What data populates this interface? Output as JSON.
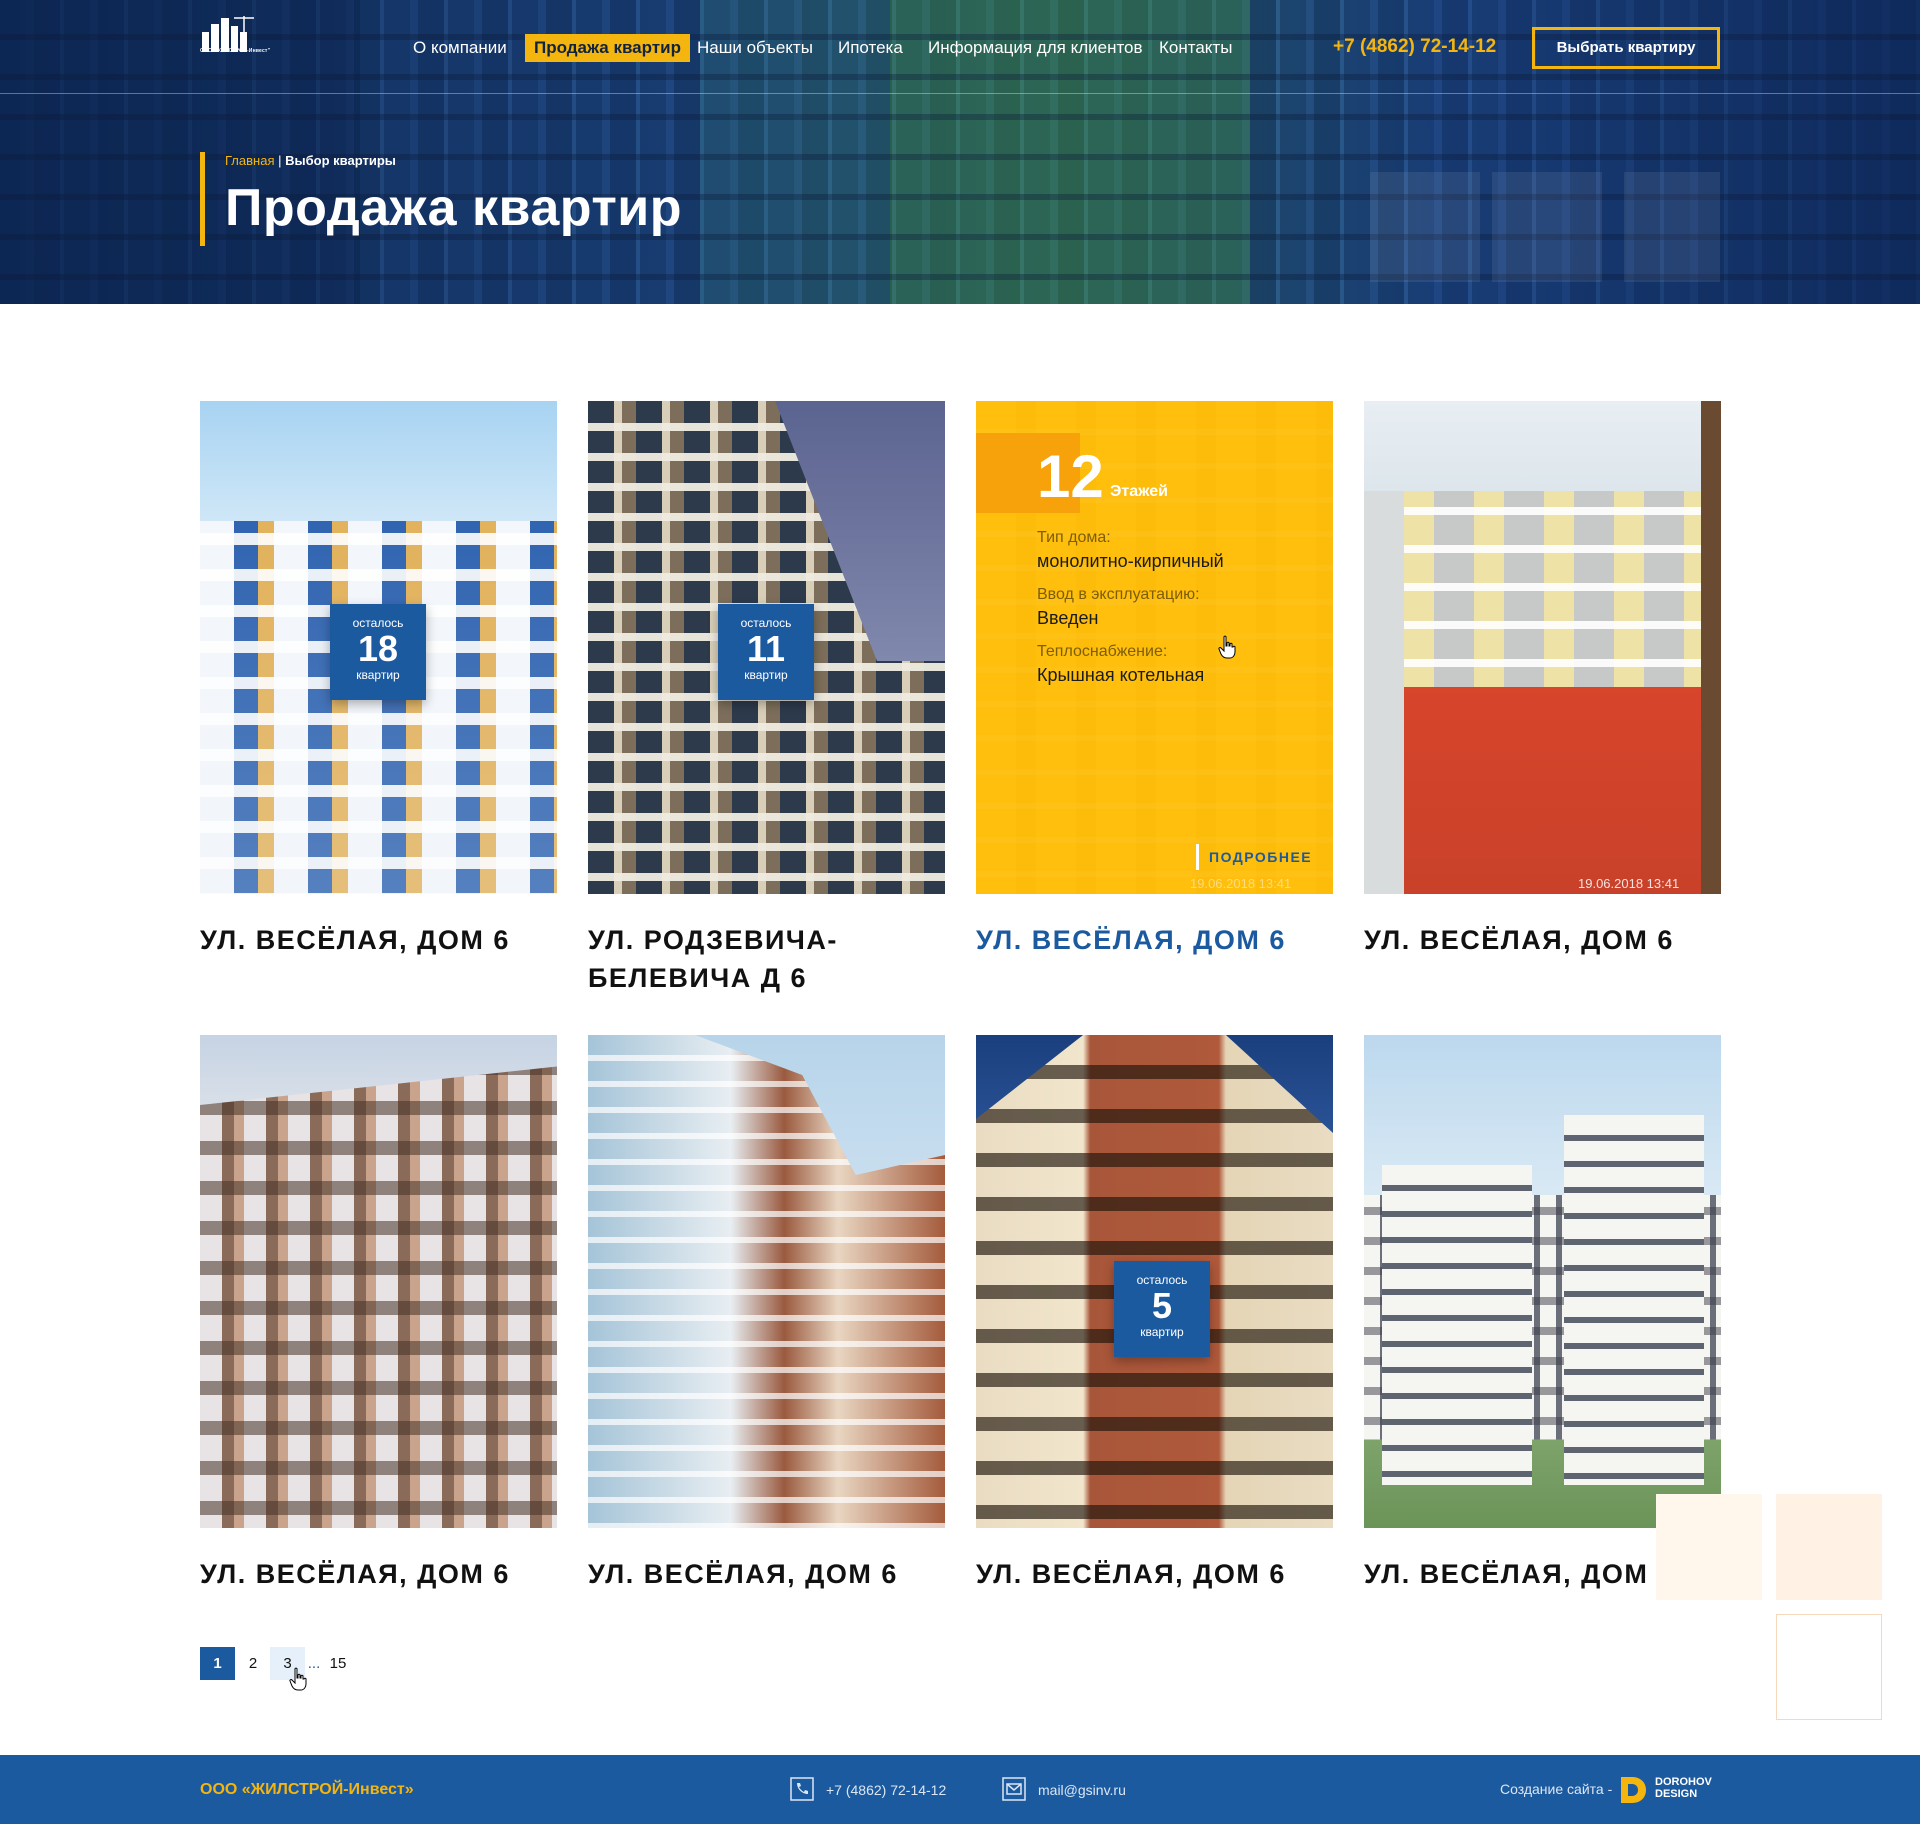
{
  "colors": {
    "accent": "#f5b50f",
    "primary": "#1c5aa0",
    "footer_bg": "#1c5aa0"
  },
  "header": {
    "logo_text": "ООО \"ЖИЛСТРОЙ-Инвест\"",
    "nav": [
      {
        "label": "О компании"
      },
      {
        "label": "Продажа квартир"
      },
      {
        "label": "Наши объекты"
      },
      {
        "label": "Ипотека"
      },
      {
        "label": "Информация для клиентов"
      },
      {
        "label": "Контакты"
      }
    ],
    "phone": "+7 (4862) 72-14-12",
    "cta_label": "Выбрать квартиру"
  },
  "breadcrumb": {
    "home": "Главная",
    "separator": "|",
    "current": "Выбор квартиры"
  },
  "page_title": "Продажа квартир",
  "cards": [
    {
      "title": "УЛ. ВЕСЁЛАЯ, ДОМ 6",
      "badge": {
        "top": "осталось",
        "count": "18",
        "bottom": "квартир"
      }
    },
    {
      "title": "УЛ. РОДЗЕВИЧА-БЕЛЕВИЧА Д 6",
      "badge": {
        "top": "осталось",
        "count": "11",
        "bottom": "квартир"
      }
    },
    {
      "title": "УЛ. ВЕСЁЛАЯ, ДОМ 6",
      "overlay": {
        "floors": "12",
        "floors_label": "Этажей",
        "house_type_label": "Тип дома:",
        "house_type_value": "монолитно-кирпичный",
        "commission_label": "Ввод в эксплуатацию:",
        "commission_value": "Введен",
        "heating_label": "Теплоснабжение:",
        "heating_value": "Крышная котельная",
        "more_label": "ПОДРОБНЕЕ",
        "photo_stamp": "19.06.2018 13:41"
      }
    },
    {
      "title": "УЛ. ВЕСЁЛАЯ, ДОМ 6",
      "photo_stamp": "19.06.2018  13:41"
    },
    {
      "title": "УЛ. ВЕСЁЛАЯ, ДОМ 6"
    },
    {
      "title": "УЛ. ВЕСЁЛАЯ, ДОМ 6"
    },
    {
      "title": "УЛ. ВЕСЁЛАЯ, ДОМ 6",
      "badge": {
        "top": "осталось",
        "count": "5",
        "bottom": "квартир"
      }
    },
    {
      "title": "УЛ. ВЕСЁЛАЯ, ДОМ 6"
    }
  ],
  "pagination": {
    "pages": [
      "1",
      "2",
      "3"
    ],
    "dots": "...",
    "last": "15",
    "current": "1"
  },
  "footer": {
    "company": "ООО «ЖИЛСТРОЙ-Инвест»",
    "phone": "+7 (4862) 72-14-12",
    "email": "mail@gsinv.ru",
    "credit": "Создание сайта -",
    "studio_line1": "DOROHOV",
    "studio_line2": "DESIGN"
  }
}
